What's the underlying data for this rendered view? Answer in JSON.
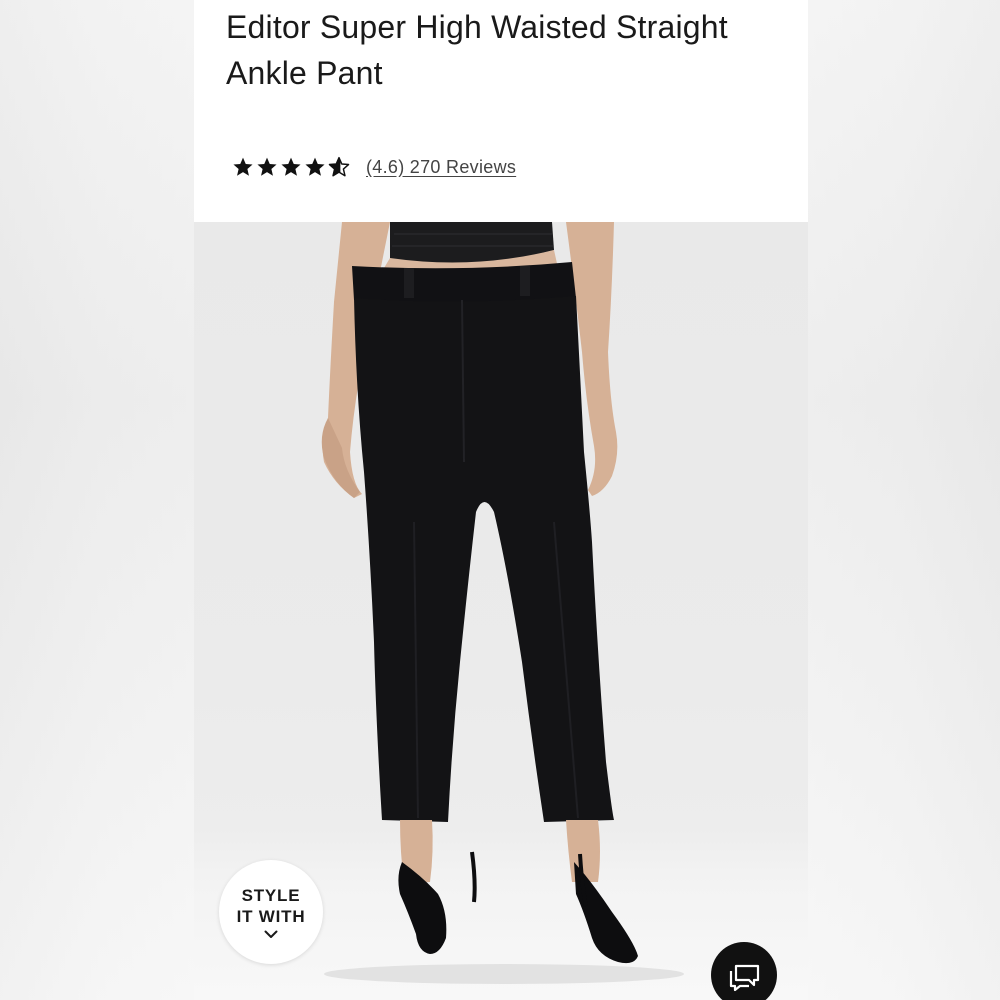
{
  "product": {
    "title": "Editor Super High Waisted Straight Ankle Pant",
    "rating_value": 4.6,
    "rating_max": 5,
    "review_link_text": "(4.6) 270 Reviews"
  },
  "style_button": {
    "line1": "STYLE",
    "line2": "IT WITH",
    "icon": "chevron-down-icon"
  },
  "chat_button": {
    "icon": "chat-bubbles-icon"
  },
  "colors": {
    "panel_bg": "#ffffff",
    "text_primary": "#1a1a1a",
    "link_text": "#444444",
    "star": "#111111",
    "photo_bg": "#ebebeb",
    "garment": "#131315",
    "chat_bg": "#111111"
  }
}
